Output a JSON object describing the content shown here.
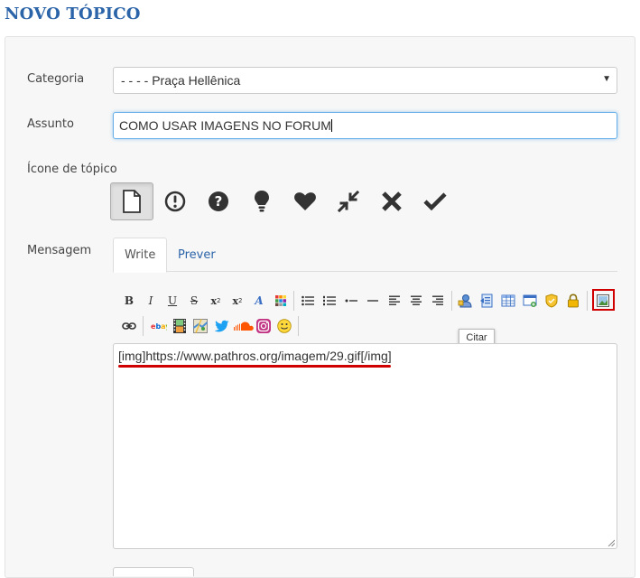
{
  "page": {
    "title": "NOVO TÓPICO"
  },
  "form": {
    "category": {
      "label": "Categoria",
      "value": "- - - - Praça Hellênica"
    },
    "subject": {
      "label": "Assunto",
      "value": "COMO USAR IMAGENS NO FORUM"
    },
    "topic_icon": {
      "label": "Ícone de tópico",
      "options": [
        "document-icon",
        "exclamation-circle-icon",
        "question-circle-icon",
        "lightbulb-icon",
        "heart-icon",
        "compress-icon",
        "x-mark-icon",
        "checkmark-icon"
      ],
      "selected": "document-icon"
    },
    "message": {
      "label": "Mensagem",
      "tabs": [
        {
          "label": "Write",
          "active": true
        },
        {
          "label": "Prever",
          "active": false
        }
      ],
      "toolbar_row1": [
        "B",
        "I",
        "U",
        "S",
        "x",
        "x",
        "A"
      ],
      "value": "[img]https://www.pathros.org/imagem/29.gif[/img]",
      "tooltip": "Citar"
    }
  },
  "colors": {
    "accent": "#2b64a8",
    "highlight": "#d00000"
  }
}
